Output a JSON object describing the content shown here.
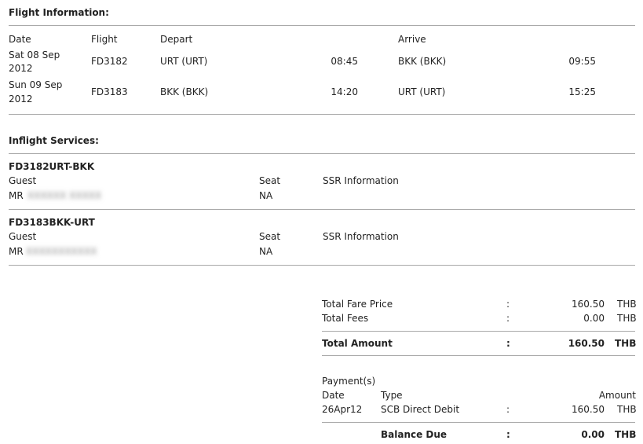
{
  "flight_info": {
    "title": "Flight Information:",
    "headers": {
      "date": "Date",
      "flight": "Flight",
      "depart": "Depart",
      "arrive": "Arrive"
    },
    "rows": [
      {
        "date_line1": "Sat 08 Sep",
        "date_line2": "2012",
        "flight": "FD3182",
        "depart": "URT (URT)",
        "depart_time": "08:45",
        "arrive": "BKK (BKK)",
        "arrive_time": "09:55"
      },
      {
        "date_line1": "Sun 09 Sep",
        "date_line2": "2012",
        "flight": "FD3183",
        "depart": "BKK (BKK)",
        "depart_time": "14:20",
        "arrive": "URT (URT)",
        "arrive_time": "15:25"
      }
    ]
  },
  "inflight": {
    "title": "Inflight Services:",
    "segments": [
      {
        "code": "FD3182URT-BKK",
        "guest_label": "Guest",
        "seat_label": "Seat",
        "ssr_label": "SSR Information",
        "guest_title": "MR",
        "guest_name": "XXXXXX XXXXX",
        "seat": "NA"
      },
      {
        "code": "FD3183BKK-URT",
        "guest_label": "Guest",
        "seat_label": "Seat",
        "ssr_label": "SSR Information",
        "guest_title": "MR",
        "guest_name": "XXXXXXXXXXX",
        "seat": "NA"
      }
    ]
  },
  "totals": {
    "colon": ":",
    "fare_label": "Total Fare Price",
    "fare_value": "160.50",
    "fare_currency": "THB",
    "fees_label": "Total Fees",
    "fees_value": "0.00",
    "fees_currency": "THB",
    "amount_label": "Total Amount",
    "amount_value": "160.50",
    "amount_currency": "THB"
  },
  "payments": {
    "title": "Payment(s)",
    "date_header": "Date",
    "type_header": "Type",
    "amount_header": "Amount",
    "rows": [
      {
        "date": "26Apr12",
        "type": "SCB Direct Debit",
        "amount": "160.50",
        "currency": "THB"
      }
    ],
    "balance_label": "Balance Due",
    "balance_value": "0.00",
    "balance_currency": "THB"
  }
}
